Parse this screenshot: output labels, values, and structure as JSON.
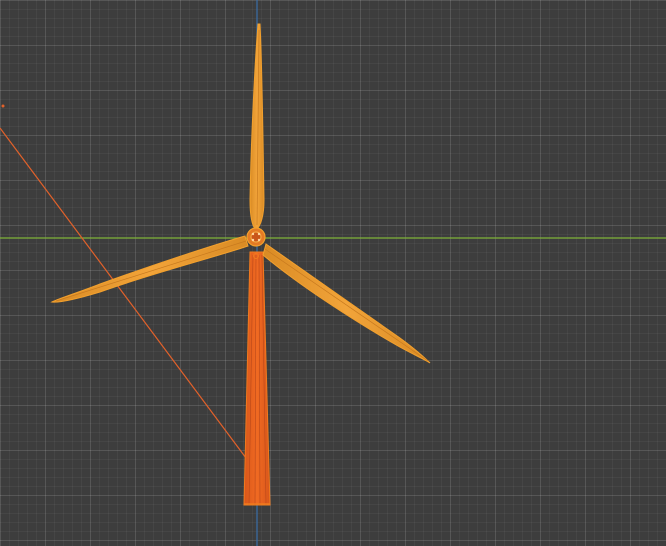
{
  "viewport": {
    "background_color": "#3d3d3d",
    "grid_line_color": "#4a4a4a",
    "x_axis_color": "#7fb43a",
    "y_axis_color": "#3a6ea8",
    "selection_color": "#f07a1e",
    "active_color": "#f2a02d"
  },
  "scene": {
    "objects": [
      {
        "name": "tower",
        "type": "mesh",
        "selected": true
      },
      {
        "name": "hub",
        "type": "mesh",
        "selected": true
      },
      {
        "name": "blade-top",
        "type": "mesh",
        "selected": true
      },
      {
        "name": "blade-left",
        "type": "mesh",
        "selected": true
      },
      {
        "name": "blade-right",
        "type": "mesh",
        "selected": true
      },
      {
        "name": "relationship-line",
        "type": "overlay"
      }
    ]
  }
}
